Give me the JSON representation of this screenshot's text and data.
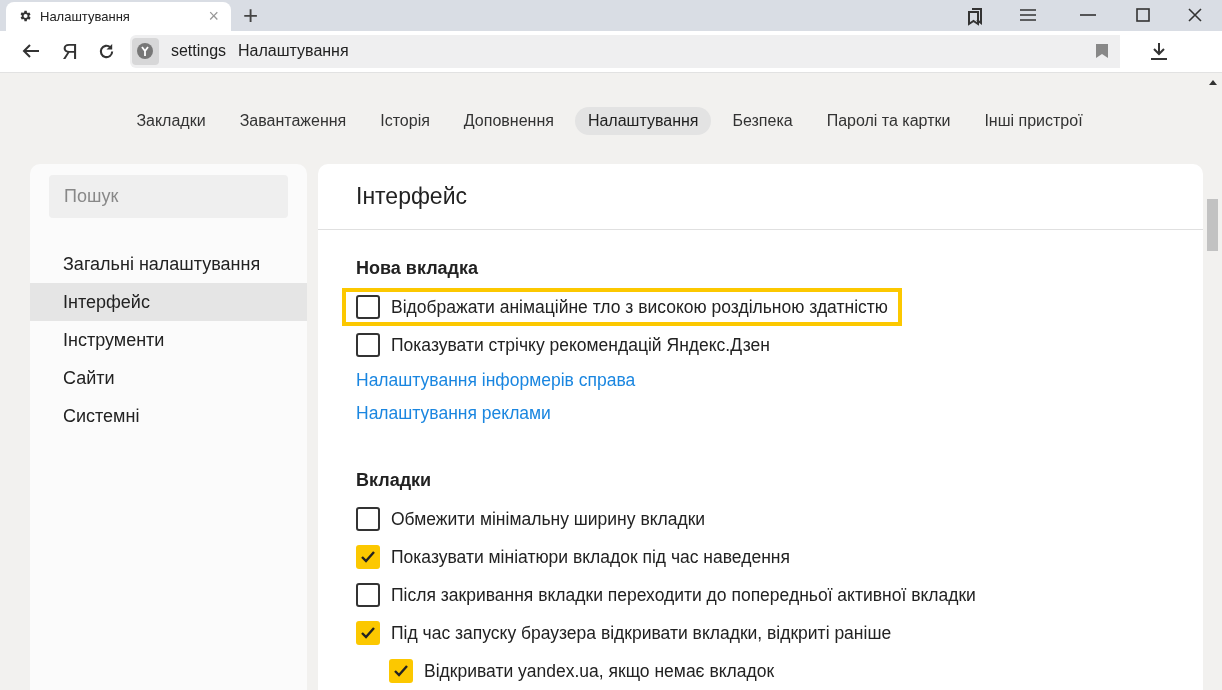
{
  "browser_tab": {
    "title": "Налаштування",
    "close": "×",
    "new_tab": "+"
  },
  "address_bar": {
    "home": "Я",
    "host": "settings",
    "page_title": "Налаштування"
  },
  "top_nav": [
    {
      "label": "Закладки",
      "selected": false
    },
    {
      "label": "Завантаження",
      "selected": false
    },
    {
      "label": "Історія",
      "selected": false
    },
    {
      "label": "Доповнення",
      "selected": false
    },
    {
      "label": "Налаштування",
      "selected": true
    },
    {
      "label": "Безпека",
      "selected": false
    },
    {
      "label": "Паролі та картки",
      "selected": false
    },
    {
      "label": "Інші пристрої",
      "selected": false
    }
  ],
  "sidebar": {
    "search": {
      "placeholder": "Пошук"
    },
    "items": [
      {
        "label": "Загальні налаштування",
        "selected": false
      },
      {
        "label": "Інтерфейс",
        "selected": true
      },
      {
        "label": "Інструменти",
        "selected": false
      },
      {
        "label": "Сайти",
        "selected": false
      },
      {
        "label": "Системні",
        "selected": false
      }
    ]
  },
  "main": {
    "title": "Інтерфейс",
    "sections": [
      {
        "heading": "Нова вкладка",
        "items": [
          {
            "kind": "checkbox",
            "label": "Відображати анімаційне тло з високою роздільною здатністю",
            "checked": false,
            "highlighted": true
          },
          {
            "kind": "checkbox",
            "label": "Показувати стрічку рекомендацій Яндекс.Дзен",
            "checked": false,
            "highlighted": false
          },
          {
            "kind": "link",
            "label": "Налаштування інформерів справа"
          },
          {
            "kind": "link",
            "label": "Налаштування реклами"
          }
        ]
      },
      {
        "heading": "Вкладки",
        "items": [
          {
            "kind": "checkbox",
            "label": "Обмежити мінімальну ширину вкладки",
            "checked": false,
            "highlighted": false
          },
          {
            "kind": "checkbox",
            "label": "Показувати мініатюри вкладок під час наведення",
            "checked": true,
            "highlighted": false
          },
          {
            "kind": "checkbox",
            "label": "Після закривання вкладки переходити до попередньої активної вкладки",
            "checked": false,
            "highlighted": false
          },
          {
            "kind": "checkbox",
            "label": "Під час запуску браузера відкривати вкладки, відкриті раніше",
            "checked": true,
            "highlighted": false,
            "children": [
              {
                "kind": "checkbox",
                "label": "Відкривати yandex.ua, якщо немає вкладок",
                "checked": true,
                "highlighted": false
              }
            ]
          }
        ]
      }
    ]
  }
}
